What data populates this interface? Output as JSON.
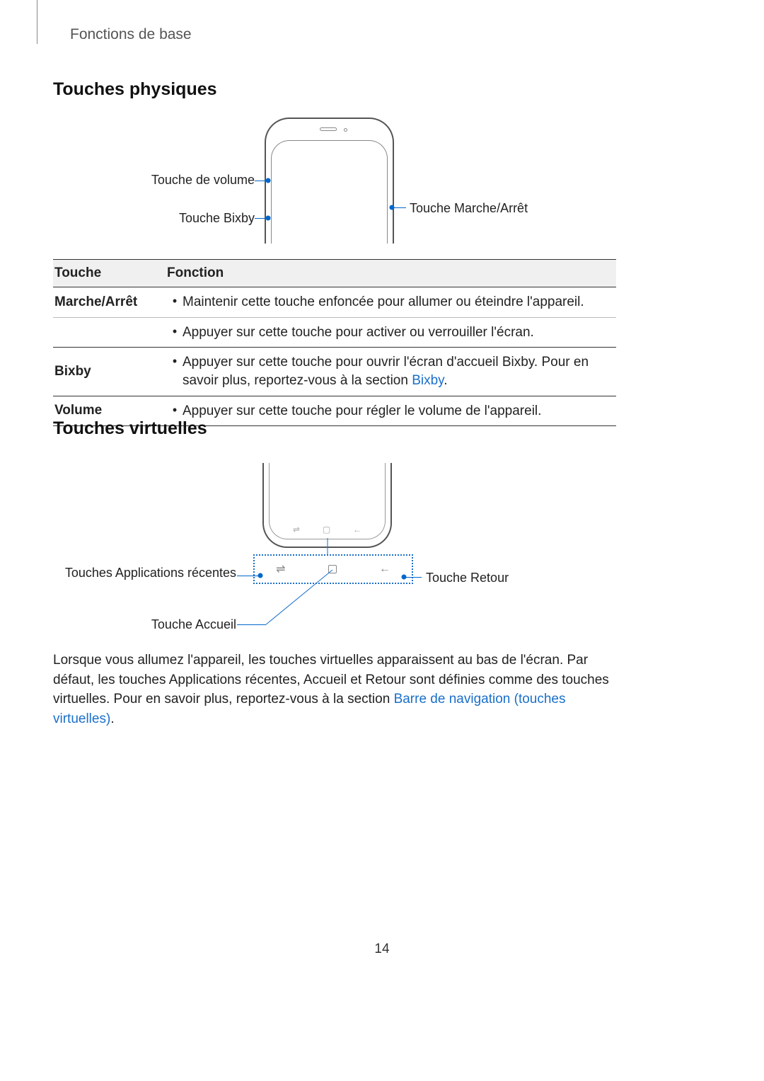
{
  "header": {
    "breadcrumb": "Fonctions de base"
  },
  "section1": {
    "title": "Touches physiques"
  },
  "diagram1": {
    "label_volume": "Touche de volume",
    "label_bixby": "Touche Bixby",
    "label_power": "Touche Marche/Arrêt"
  },
  "table": {
    "head_key": "Touche",
    "head_func": "Fonction",
    "rows": [
      {
        "key": "Marche/Arrêt",
        "func": "Maintenir cette touche enfoncée pour allumer ou éteindre l'appareil."
      },
      {
        "key": "",
        "func": "Appuyer sur cette touche pour activer ou verrouiller l'écran."
      },
      {
        "key": "Bixby",
        "func_prefix": "Appuyer sur cette touche pour ouvrir l'écran d'accueil Bixby. Pour en savoir plus, reportez-vous à la section ",
        "func_link": "Bixby",
        "func_suffix": "."
      },
      {
        "key": "Volume",
        "func": "Appuyer sur cette touche pour régler le volume de l'appareil."
      }
    ]
  },
  "section2": {
    "title": "Touches virtuelles"
  },
  "diagram2": {
    "label_recent": "Touches Applications récentes",
    "label_home": "Touche Accueil",
    "label_back": "Touche Retour"
  },
  "paragraph": {
    "text_prefix": "Lorsque vous allumez l'appareil, les touches virtuelles apparaissent au bas de l'écran. Par défaut, les touches Applications récentes, Accueil et Retour sont définies comme des touches virtuelles. Pour en savoir plus, reportez-vous à la section ",
    "link": "Barre de navigation (touches virtuelles)",
    "text_suffix": "."
  },
  "page_number": "14"
}
